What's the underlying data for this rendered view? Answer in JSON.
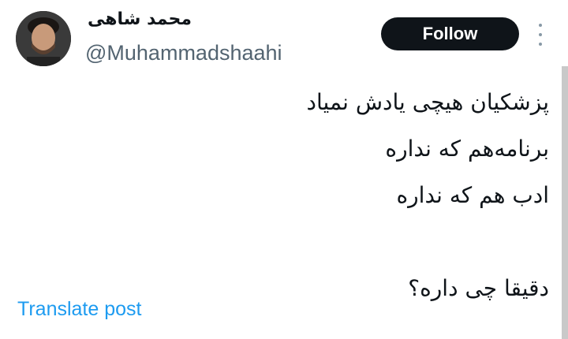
{
  "author": {
    "display_name": "محمد شاهی",
    "handle": "@Muhammadshaahi"
  },
  "actions": {
    "follow_label": "Follow",
    "more_icon": "more-vertical-icon"
  },
  "tweet": {
    "lines": [
      "پزشکیان هیچی یادش نمیاد",
      "برنامه‌هم که نداره",
      "ادب هم که نداره",
      "",
      "دقیقا چی داره؟"
    ]
  },
  "footer": {
    "translate_label": "Translate post"
  },
  "colors": {
    "button_bg": "#0f1419",
    "handle_gray": "#536471",
    "link_blue": "#1d9bf0"
  }
}
